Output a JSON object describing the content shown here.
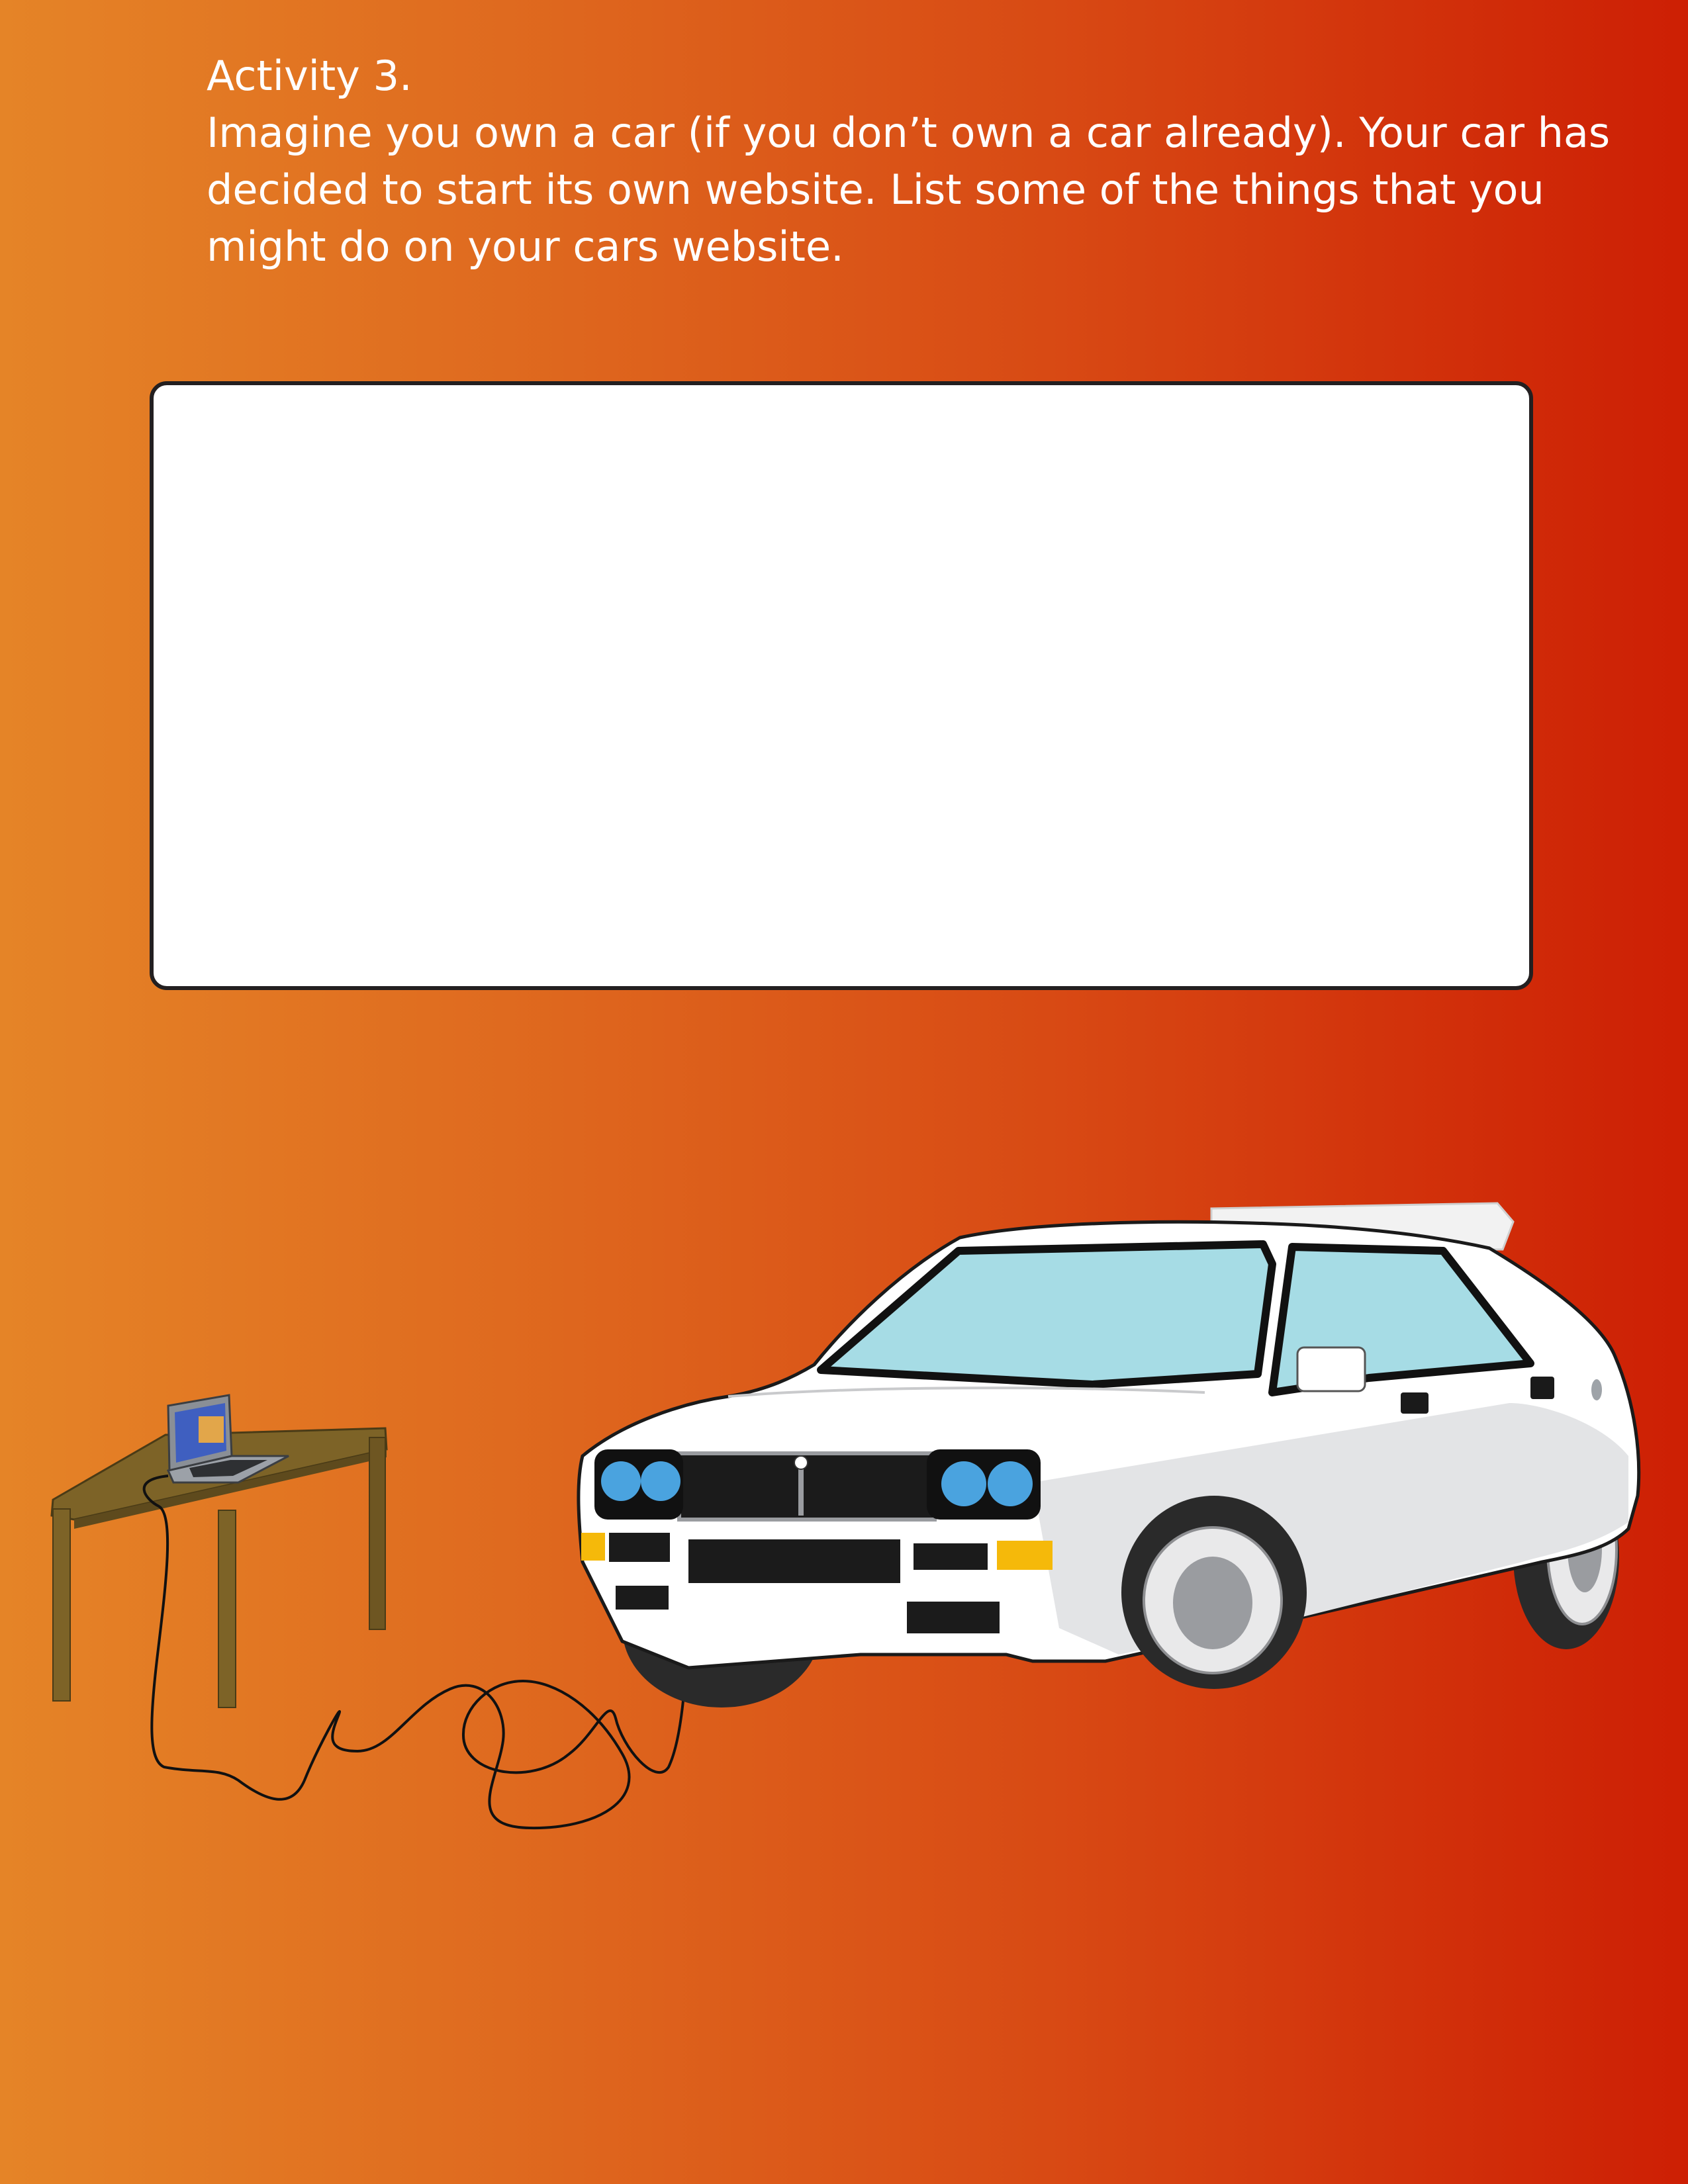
{
  "activity": {
    "heading": "Activity 3.",
    "prompt_lines": [
      "Imagine you own a car (if you don’t own a car already). Your car has",
      "decided to start its own website. List some of the things that you",
      "might do on your cars website."
    ]
  },
  "answer_box": {
    "value": ""
  },
  "illustration": {
    "objects": [
      "laptop-icon",
      "table-icon",
      "cable-icon",
      "car-icon"
    ],
    "colors": {
      "background_left": "#e58427",
      "background_right": "#cd1f04",
      "table": "#7d6327",
      "car_body": "#ffffff",
      "windshield": "#a6dce5",
      "headlights": "#4aa3df",
      "indicator_lights": "#f5b90a"
    }
  }
}
